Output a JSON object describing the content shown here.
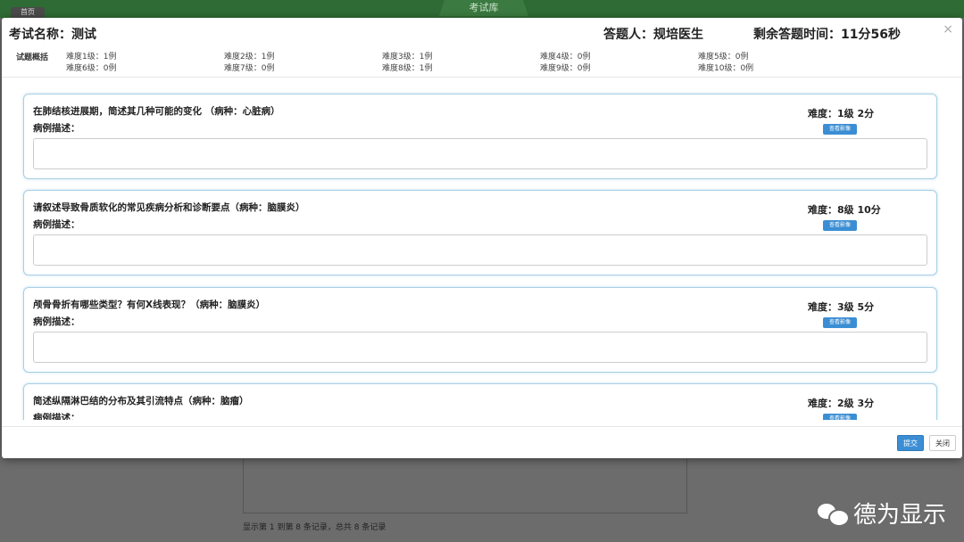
{
  "background": {
    "home_tab": "首页",
    "center_tab": "考试库",
    "footer_text": "显示第 1 到第 8 条记录，总共 8 条记录",
    "watermark": "德为显示"
  },
  "modal": {
    "close_symbol": "×",
    "exam_name": "考试名称：测试",
    "examinee": "答题人：规培医生",
    "remaining_time": "剩余答题时间：11分56秒",
    "summary_label": "试题概括",
    "summary": [
      "难度1级：1例",
      "难度2级：1例",
      "难度3级：1例",
      "难度4级：0例",
      "难度5级：0例",
      "难度6级：0例",
      "难度7级：0例",
      "难度8级：1例",
      "难度9级：0例",
      "难度10级：0例"
    ],
    "desc_label": "病例描述：",
    "view_image_label": "查看影像",
    "questions": [
      {
        "title": "在肺结核进展期，简述其几种可能的变化 （病种：心脏病）",
        "meta": "难度：1级  2分"
      },
      {
        "title": "请叙述导致骨质软化的常见疾病分析和诊断要点（病种：脑膜炎）",
        "meta": "难度：8级  10分"
      },
      {
        "title": "颅骨骨折有哪些类型？有何X线表现？（病种：脑膜炎）",
        "meta": "难度：3级  5分"
      },
      {
        "title": "简述纵隔淋巴结的分布及其引流特点（病种：脑瘤）",
        "meta": "难度：2级  3分"
      }
    ],
    "submit_label": "提交",
    "close_label": "关闭"
  }
}
